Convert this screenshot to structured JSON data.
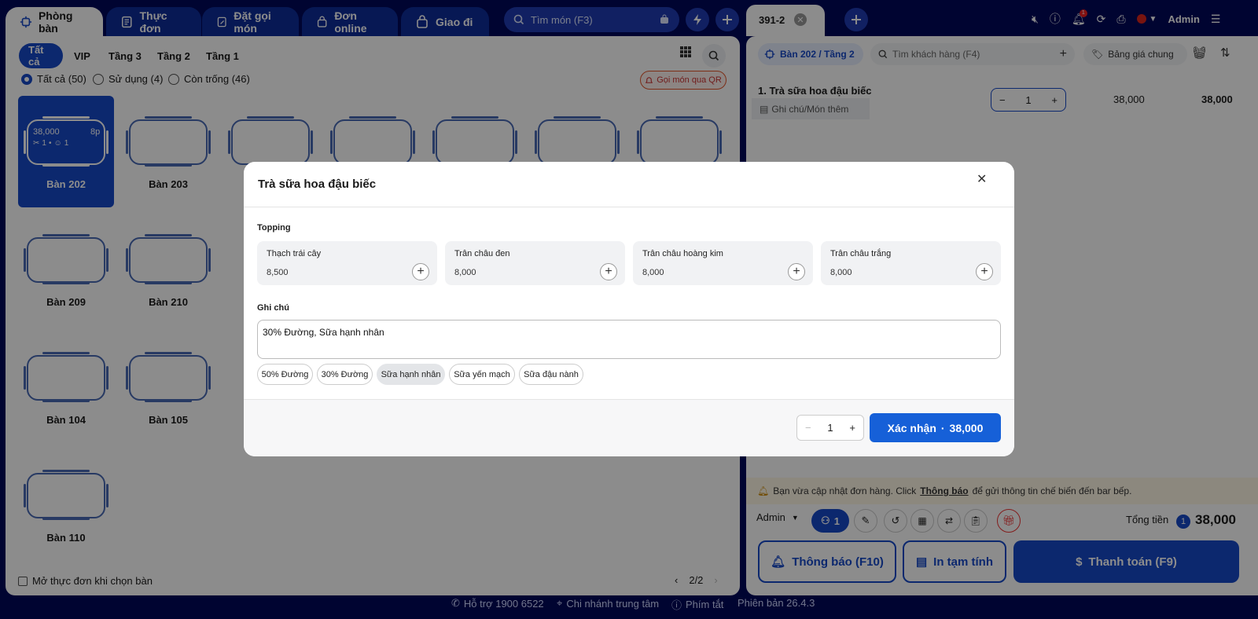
{
  "topnav": {
    "tabs": [
      "Phòng bàn",
      "Thực đơn",
      "Đặt gọi món",
      "Đơn online",
      "Giao đi"
    ],
    "search_placeholder": "Tìm món (F3)"
  },
  "left": {
    "floors": [
      "Tất cả",
      "VIP",
      "Tầng 3",
      "Tầng 2",
      "Tầng 1"
    ],
    "filters": [
      "Tất cả (50)",
      "Sử dụng (4)",
      "Còn trống (46)"
    ],
    "qr_button": "Gọi món qua QR",
    "selected_table": {
      "amount": "38,000",
      "time": "8p",
      "items": "1",
      "people": "1"
    },
    "tables": [
      "Bàn 202",
      "Bàn 203",
      "Bàn 209",
      "Bàn 210",
      "Bàn 104",
      "Bàn 105",
      "Bàn 110"
    ],
    "open_menu_label": "Mở thực đơn khi chọn bàn",
    "pagination": "2/2"
  },
  "right": {
    "order_tab": "391-2",
    "admin": "Admin",
    "notif_count": "1",
    "table_chip": "Bàn 202 / Tầng 2",
    "customer_placeholder": "Tìm khách hàng (F4)",
    "price_list": "Bảng giá chung",
    "item": {
      "name": "1. Trà sữa hoa đậu biếc",
      "note_placeholder": "Ghi chú/Món thêm",
      "qty": "1",
      "unit_price": "38,000",
      "total": "38,000"
    },
    "notice_pre": "Bạn vừa cập nhật đơn hàng. Click",
    "notice_link": "Thông báo",
    "notice_post": "để gửi thông tin chế biến đến bar bếp.",
    "staff": "Admin",
    "guest_count": "1",
    "total_label": "Tổng tiền",
    "total_badge": "1",
    "total_value": "38,000",
    "btn_notify": "Thông báo (F10)",
    "btn_print": "In tạm tính",
    "btn_pay": "Thanh toán (F9)"
  },
  "modal": {
    "title": "Trà sữa hoa đậu biếc",
    "topping_label": "Topping",
    "toppings": [
      {
        "name": "Thạch trái cây",
        "price": "8,500"
      },
      {
        "name": "Trân châu đen",
        "price": "8,000"
      },
      {
        "name": "Trân châu hoàng kim",
        "price": "8,000"
      },
      {
        "name": "Trân châu trắng",
        "price": "8,000"
      }
    ],
    "note_label": "Ghi chú",
    "note_value": "30% Đường, Sữa hạnh nhân",
    "quick_notes": [
      "50% Đường",
      "30% Đường",
      "Sữa hạnh nhân",
      "Sữa yến mạch",
      "Sữa đậu nành"
    ],
    "qty": "1",
    "confirm_label": "Xác nhận",
    "confirm_amount": "38,000"
  },
  "footer": {
    "support": "Hỗ trợ 1900 6522",
    "branch": "Chi nhánh trung tâm",
    "shortcuts": "Phím tắt",
    "version": "Phiên bản 26.4.3"
  }
}
